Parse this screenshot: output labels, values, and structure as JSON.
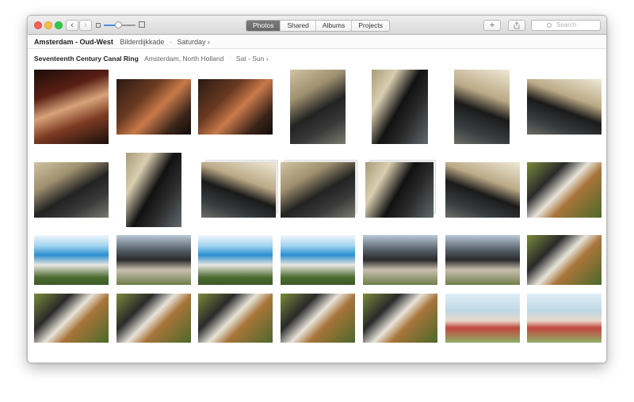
{
  "window": {
    "nav": {
      "back_icon": "chevron-left-icon",
      "forward_icon": "chevron-right-icon",
      "back_glyph": "‹",
      "forward_glyph": "›"
    },
    "zoom": {
      "level": 0.45
    },
    "tabs": [
      {
        "label": "Photos",
        "active": true
      },
      {
        "label": "Shared",
        "active": false
      },
      {
        "label": "Albums",
        "active": false
      },
      {
        "label": "Projects",
        "active": false
      }
    ],
    "add_glyph": "+",
    "share_icon": "share-icon",
    "search": {
      "placeholder": "Search"
    }
  },
  "header": {
    "title": "Amsterdam - Oud-West",
    "location": "Bilderdijkkade",
    "separator": "·",
    "date": "Saturday ›"
  },
  "moment": {
    "title": "Seventeenth Century Canal Ring",
    "location": "Amsterdam, North Holland",
    "separator": "·",
    "date": "Sat - Sun ›"
  },
  "photos": [
    {
      "name": "photo-bar-cat",
      "style": "p-bar2"
    },
    {
      "name": "photo-bar-woman",
      "style": "p-bar"
    },
    {
      "name": "photo-bar-woman-2",
      "style": "p-bar"
    },
    {
      "name": "photo-cat-1",
      "style": "p-cat"
    },
    {
      "name": "photo-cat-2",
      "style": "p-cat2"
    },
    {
      "name": "photo-cat-3",
      "style": "p-cat3"
    },
    {
      "name": "photo-cat-4",
      "style": "p-cat3"
    },
    {
      "name": "photo-cat-5",
      "style": "p-cat"
    },
    {
      "name": "photo-cat-6",
      "style": "p-cat2"
    },
    {
      "name": "photo-cat-stack-1",
      "style": "p-cat3"
    },
    {
      "name": "photo-cat-stack-2",
      "style": "p-cat"
    },
    {
      "name": "photo-cat-stack-3",
      "style": "p-cat2"
    },
    {
      "name": "photo-cat-7",
      "style": "p-cat3"
    },
    {
      "name": "photo-festival-1",
      "style": "p-cook"
    },
    {
      "name": "photo-festival-2",
      "style": "p-festA"
    },
    {
      "name": "photo-festival-3",
      "style": "p-festB"
    },
    {
      "name": "photo-festival-4",
      "style": "p-festA"
    },
    {
      "name": "photo-festival-5",
      "style": "p-festA"
    },
    {
      "name": "photo-festival-6",
      "style": "p-festB"
    },
    {
      "name": "photo-festival-7",
      "style": "p-festB"
    },
    {
      "name": "photo-festival-8",
      "style": "p-cook"
    },
    {
      "name": "photo-cooking-1",
      "style": "p-cook"
    },
    {
      "name": "photo-cooking-2",
      "style": "p-cook"
    },
    {
      "name": "photo-cooking-3",
      "style": "p-cook"
    },
    {
      "name": "photo-cooking-4",
      "style": "p-cook"
    },
    {
      "name": "photo-cooking-5",
      "style": "p-cook"
    },
    {
      "name": "photo-blur-1",
      "style": "p-blur"
    },
    {
      "name": "photo-blur-2",
      "style": "p-blur"
    }
  ]
}
